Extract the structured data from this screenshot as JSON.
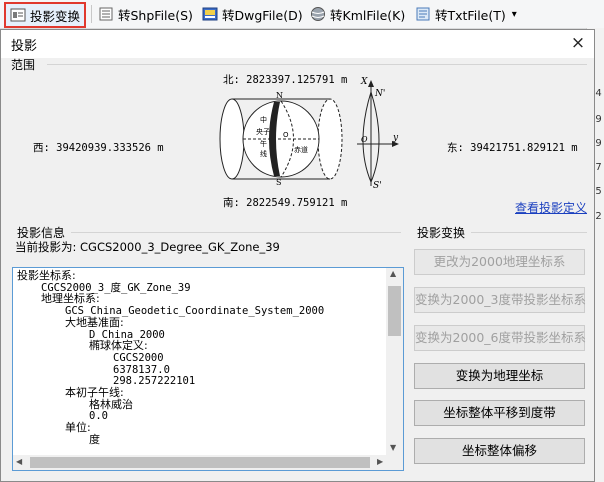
{
  "toolbar": {
    "project_label": "投影变换",
    "shp_label": "转ShpFile(S)",
    "dwg_label": "转DwgFile(D)",
    "kml_label": "转KmlFile(K)",
    "txt_label": "转TxtFile(T)",
    "dropdown_arrow": "▾"
  },
  "right_strip": [
    "74",
    "29",
    "89",
    "97",
    "15",
    "42"
  ],
  "dialog": {
    "title": "投影",
    "close": "×",
    "range": {
      "label": "范围",
      "north": "北: 2823397.125791  m",
      "south": "南: 2822549.759121  m",
      "west": "西: 39420939.333526  m",
      "east": "东: 39421751.829121  m",
      "view_projection_link": "查看投影定义"
    },
    "globe": {
      "n": "N",
      "s": "S",
      "central": "中",
      "meridian": "央子",
      "wu": "午",
      "line": "线",
      "equator": "赤道",
      "o": "O"
    },
    "axes": {
      "x": "X",
      "y": "y",
      "n_prime": "N'",
      "s_prime": "S'",
      "o": "O"
    },
    "projection_info": {
      "label": "投影信息",
      "current": "当前投影为: CGCS2000_3_Degree_GK_Zone_39"
    },
    "tree": [
      {
        "indent": 0,
        "text": "投影坐标系:",
        "mono": false
      },
      {
        "indent": 1,
        "text": "CGCS2000_3_度_GK_Zone_39",
        "mono": true
      },
      {
        "indent": 1,
        "text": "地理坐标系:",
        "mono": false
      },
      {
        "indent": 2,
        "text": "GCS_China_Geodetic_Coordinate_System_2000",
        "mono": true
      },
      {
        "indent": 2,
        "text": "大地基准面:",
        "mono": false
      },
      {
        "indent": 3,
        "text": "D_China_2000",
        "mono": true
      },
      {
        "indent": 3,
        "text": "椭球体定义:",
        "mono": false
      },
      {
        "indent": 4,
        "text": "CGCS2000",
        "mono": true
      },
      {
        "indent": 4,
        "text": "6378137.0",
        "mono": true
      },
      {
        "indent": 4,
        "text": "298.257222101",
        "mono": true
      },
      {
        "indent": 2,
        "text": "本初子午线:",
        "mono": false
      },
      {
        "indent": 3,
        "text": "格林威治",
        "mono": false
      },
      {
        "indent": 3,
        "text": "0.0",
        "mono": true
      },
      {
        "indent": 2,
        "text": "单位:",
        "mono": false
      },
      {
        "indent": 3,
        "text": "度",
        "mono": false
      }
    ],
    "transform": {
      "label": "投影变换",
      "buttons": [
        {
          "label": "更改为2000地理坐标系",
          "enabled": false
        },
        {
          "label": "变换为2000_3度带投影坐标系",
          "enabled": false
        },
        {
          "label": "变换为2000_6度带投影坐标系",
          "enabled": false
        },
        {
          "label": "变换为地理坐标",
          "enabled": true
        },
        {
          "label": "坐标整体平移到度带",
          "enabled": true
        },
        {
          "label": "坐标整体偏移",
          "enabled": true
        }
      ]
    }
  },
  "scroll": {
    "up": "▲",
    "down": "▼",
    "left": "◀",
    "right": "▶"
  },
  "colors": {
    "highlight_border": "#e0392e",
    "link": "#1a3fbf",
    "info_border": "#5b9bd5"
  }
}
